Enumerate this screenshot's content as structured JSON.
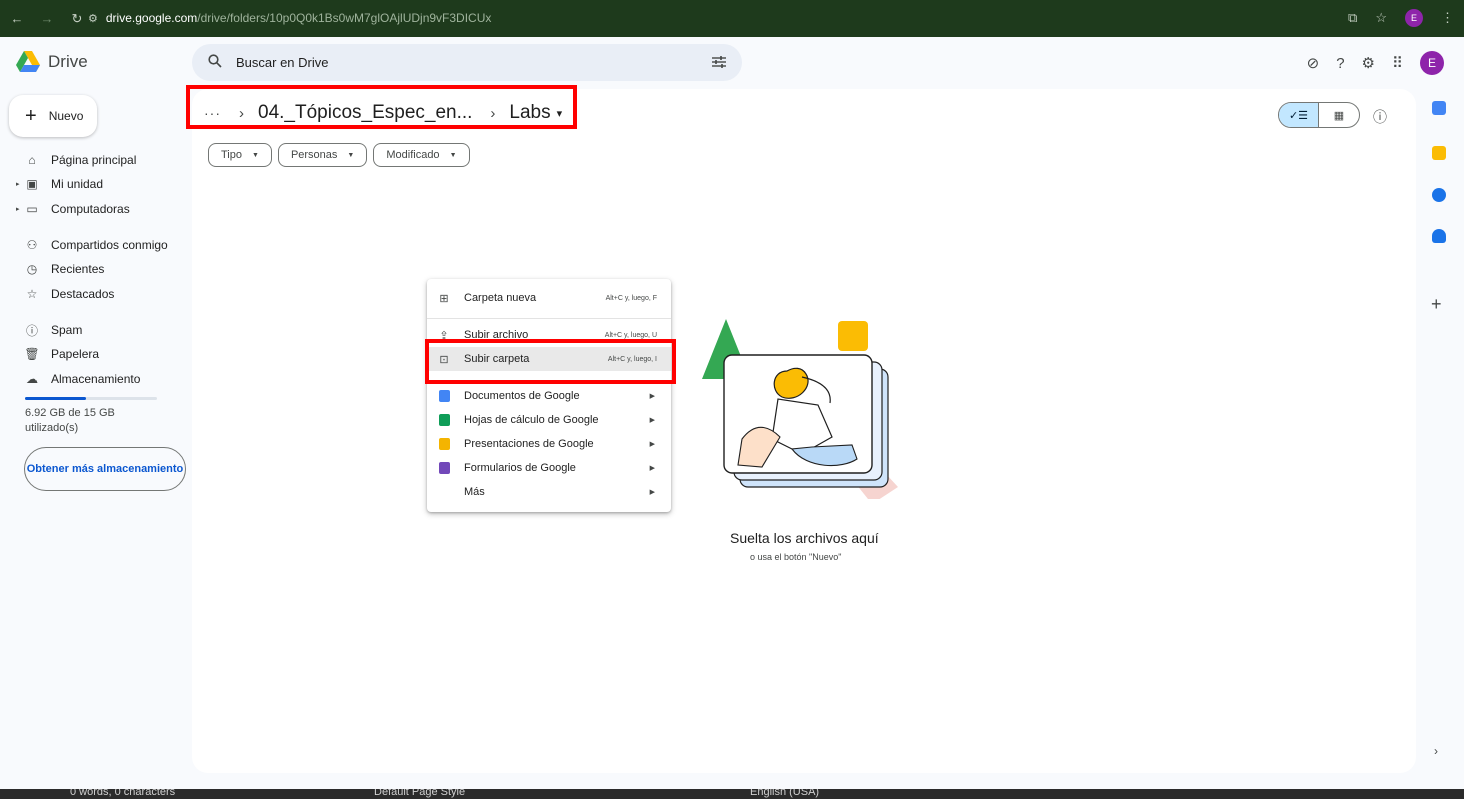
{
  "browser": {
    "url_host": "drive.google.com",
    "url_path": "/drive/folders/10p0Q0k1Bs0wM7glOAjlUDjn9vF3DICUx",
    "profile_initial": "E"
  },
  "header": {
    "app_name": "Drive",
    "search_placeholder": "Buscar en Drive",
    "avatar_initial": "E"
  },
  "sidebar": {
    "new_label": "Nuevo",
    "items": [
      {
        "label": "Página principal"
      },
      {
        "label": "Mi unidad"
      },
      {
        "label": "Computadoras"
      },
      {
        "label": "Compartidos conmigo"
      },
      {
        "label": "Recientes"
      },
      {
        "label": "Destacados"
      },
      {
        "label": "Spam"
      },
      {
        "label": "Papelera"
      },
      {
        "label": "Almacenamiento"
      }
    ],
    "storage_used_fraction": 0.46,
    "storage_text": "6.92 GB de 15 GB utilizado(s)",
    "get_more_label": "Obtener más almacenamiento"
  },
  "breadcrumb": {
    "overflow": "···",
    "parent": "04._Tópicos_Espec_en...",
    "current": "Labs"
  },
  "filters": [
    {
      "label": "Tipo"
    },
    {
      "label": "Personas"
    },
    {
      "label": "Modificado"
    }
  ],
  "empty_state": {
    "title": "Suelta los archivos aquí",
    "subtitle": "o usa el botón \"Nuevo\""
  },
  "menu": {
    "items": [
      {
        "label": "Carpeta nueva",
        "shortcut": "Alt+C y, luego, F"
      },
      {
        "label": "Subir archivo",
        "shortcut": "Alt+C y, luego, U"
      },
      {
        "label": "Subir carpeta",
        "shortcut": "Alt+C y, luego, I"
      },
      {
        "label": "Documentos de Google"
      },
      {
        "label": "Hojas de cálculo de Google"
      },
      {
        "label": "Presentaciones de Google"
      },
      {
        "label": "Formularios de Google"
      },
      {
        "label": "Más"
      }
    ]
  },
  "statusbar": {
    "words": "0 words, 0 characters",
    "page_style": "Default Page Style",
    "language": "English (USA)"
  },
  "colors": {
    "accent": "#0b57d0",
    "annotation": "#ff0000",
    "docs": "#4285f4",
    "sheets": "#0f9d58",
    "slides": "#f4b400",
    "forms": "#7248b9"
  }
}
